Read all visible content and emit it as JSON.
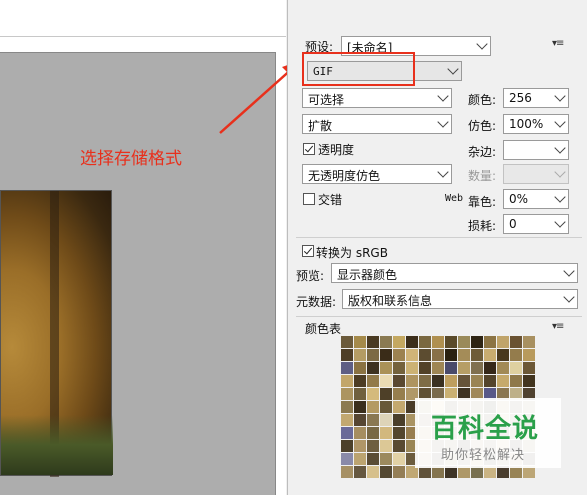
{
  "annotation": {
    "text": "选择存储格式",
    "color": "#e8301c"
  },
  "preset": {
    "label": "预设:",
    "value": "[未命名]"
  },
  "format": {
    "value": "GIF"
  },
  "reduction": {
    "value": "可选择"
  },
  "dither_algorithm": {
    "value": "扩散"
  },
  "transparency": {
    "label": "透明度",
    "checked": true
  },
  "transparency_dither": {
    "value": "无透明度仿色"
  },
  "interlaced": {
    "label": "交错",
    "checked": false
  },
  "colors": {
    "label": "颜色:",
    "value": "256"
  },
  "dither": {
    "label": "仿色:",
    "value": "100%"
  },
  "matte": {
    "label": "杂边:",
    "value": ""
  },
  "amount": {
    "label": "数量:",
    "value": ""
  },
  "web_snap": {
    "label_prefix": "Web",
    "label": "靠色:",
    "value": "0%"
  },
  "lossy": {
    "label": "损耗:",
    "value": "0"
  },
  "convert_srgb": {
    "label": "转换为 sRGB",
    "checked": true
  },
  "preview": {
    "label": "预览:",
    "value": "显示器颜色"
  },
  "metadata": {
    "label": "元数据:",
    "value": "版权和联系信息"
  },
  "color_table": {
    "label": "颜色表",
    "swatches": [
      "#6b5a3a",
      "#a58a4a",
      "#4a3a22",
      "#8a7a52",
      "#c4a860",
      "#3c2e1a",
      "#7a6840",
      "#b09050",
      "#5a4a2a",
      "#9a8a5a",
      "#2e2414",
      "#8c7444",
      "#c0a46a",
      "#6a5232",
      "#a89060",
      "#4e3e26",
      "#b49c64",
      "#7c6a44",
      "#3a2c18",
      "#9c8250",
      "#d0b478",
      "#5c4c30",
      "#887048",
      "#2a2010",
      "#a48c58",
      "#6e5c38",
      "#c8ac70",
      "#48381e",
      "#947c4c",
      "#b89a5c",
      "#5e5e84",
      "#8a7242",
      "#3e3220",
      "#aa9258",
      "#74623c",
      "#ccb274",
      "#524228",
      "#9e8654",
      "#4a4a6a",
      "#b69e66",
      "#807050",
      "#36281a",
      "#a28a56",
      "#ded0a0",
      "#6c5836",
      "#c2a66a",
      "#4c3c24",
      "#927a4a",
      "#eadcb4",
      "#5a4830",
      "#ae9460",
      "#7e6c46",
      "#3a3020",
      "#be9e5e",
      "#66543a",
      "#9a8454",
      "#54442c",
      "#c6aa6c",
      "#8e784a",
      "#42341e",
      "#ac9460",
      "#70603e",
      "#d4ba7c",
      "#4e4028",
      "#967e4e",
      "#b09868",
      "#605034",
      "#7a6a4c",
      "#cab072",
      "#3e3222",
      "#a08858",
      "#585888",
      "#8a7650",
      "#beb088",
      "#504230",
      "#8c7a50",
      "#3a2e1c",
      "#b49a62",
      "#685838",
      "#c4a86e",
      "#4a3c28",
      "#9e8858",
      "#d8c090",
      "#5e4e32",
      "#a69060",
      "#746440",
      "#342a1a",
      "#baa06a",
      "#62523a",
      "#947e52",
      "#c2a870",
      "#564632",
      "#8a7852",
      "#ded4b8",
      "#4a3e2a",
      "#aa9464",
      "#7a6a48",
      "#3e3424",
      "#b89e6c",
      "#685a40",
      "#9c8858",
      "#524430",
      "#ccb280",
      "#82704e",
      "#463a28",
      "#6a6a98",
      "#a68e60",
      "#786844",
      "#d2b87e",
      "#54462e",
      "#987e50",
      "#b29a6a",
      "#645438",
      "#7e6e4c",
      "#c6ac74",
      "#403426",
      "#a28c5c",
      "#5c4e36",
      "#8e7c54",
      "#bea672",
      "#4c402a",
      "#b09668",
      "#6e5e40",
      "#dcc896",
      "#584a32",
      "#9a8656",
      "#c4aa72",
      "#625238",
      "#867450",
      "#3c3222",
      "#a89262",
      "#766646",
      "#d0b680",
      "#4e422c",
      "#928052",
      "#8a8aa8",
      "#bca470",
      "#5a4c34",
      "#9c8a5e",
      "#e2d2a6",
      "#6c5c3e",
      "#b49c6c",
      "#44382a",
      "#a08a5c",
      "#726244",
      "#c8b07a",
      "#504432",
      "#8c7a56",
      "#b6a070",
      "#3a3024",
      "#a69064",
      "#665840",
      "#d6c08c",
      "#544832",
      "#947e56",
      "#c0a874",
      "#60523a",
      "#84744e",
      "#3e3426",
      "#ae9868",
      "#787050",
      "#cab484",
      "#4a3e2e",
      "#988456",
      "#bca676"
    ]
  },
  "watermark": {
    "title": "百科全说",
    "subtitle": "助你轻松解决",
    "title_color": "#2aa04a"
  }
}
